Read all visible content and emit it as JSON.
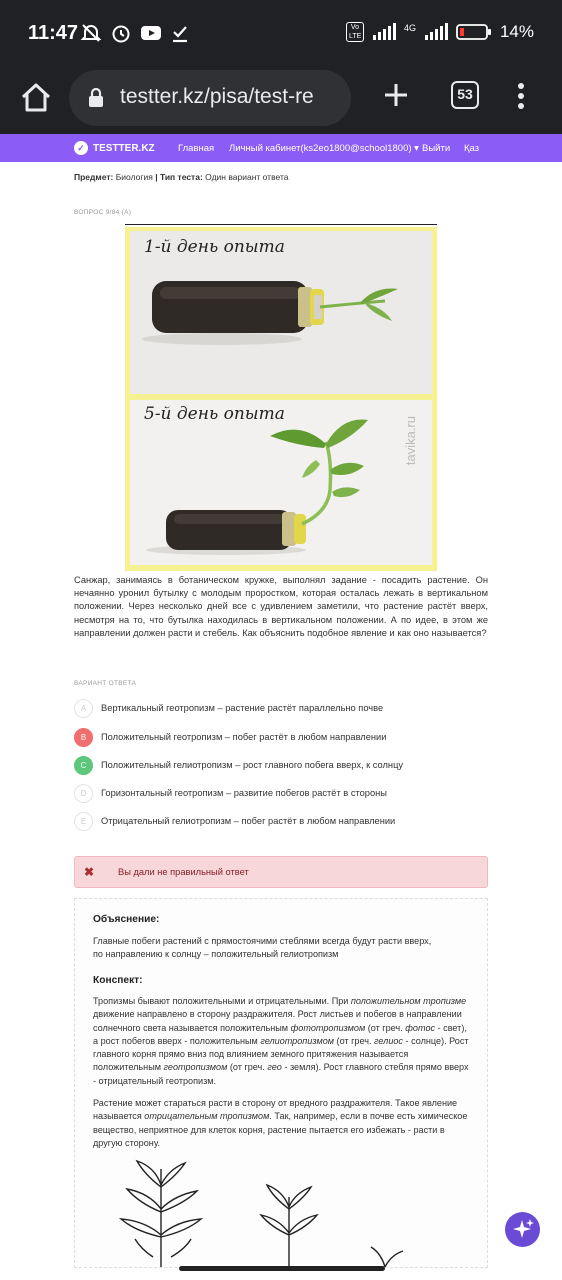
{
  "status_bar": {
    "time": "11:47",
    "signal_label": "4G",
    "volte_label": "Vo LTE",
    "battery": "14%"
  },
  "browser": {
    "url": "testter.kz/pisa/test-re",
    "tab_count": "53"
  },
  "nav": {
    "brand": "TESTTER.KZ",
    "items": [
      "Главная",
      "Личный кабинет(ks2eo1800@school1800) ▾",
      "Выйти",
      "Қаз"
    ]
  },
  "meta": {
    "subject_label": "Предмет:",
    "subject_value": "Биология",
    "separator": "|",
    "type_label": "Тип теста:",
    "type_value": "Один вариант ответа"
  },
  "question": {
    "number": "ВОПРОС 9/84",
    "flag": "(А)",
    "image": {
      "day1_label": "1-й день опыта",
      "day5_label": "5-й день опыта",
      "watermark": "tavika.ru"
    },
    "text": "Санжар, занимаясь в ботаническом кружке, выполнял задание -  посадить растение. Он нечаянно уронил бутылку с молодым проростком, которая осталась лежать в вертикальном положении. Через несколько дней все с удивлением заметили, что растение растёт вверх, несмотря на то, что бутылка находилась в вертикальном положении. А по идее, в этом же направлении должен расти и стебель. Как объяснить подобное явление и как оно называется?"
  },
  "answers": {
    "heading": "ВАРИАНТ ОТВЕТА",
    "options": [
      {
        "letter": "A",
        "text": "Вертикальный геотропизм – растение растёт параллельно почве",
        "state": "none"
      },
      {
        "letter": "B",
        "text": "Положительный геотропизм – побег растёт в любом направлении",
        "state": "wrong"
      },
      {
        "letter": "C",
        "text": "Положительный гелиотропизм – рост главного побега вверх, к солнцу",
        "state": "right"
      },
      {
        "letter": "D",
        "text": "Горизонтальный геотропизм – развитие побегов растёт в стороны",
        "state": "none"
      },
      {
        "letter": "E",
        "text": "Отрицательный гелиотропизм – побег растёт в любом направлении",
        "state": "none"
      }
    ]
  },
  "alert": {
    "icon": "✖",
    "text": "Вы дали не правильный ответ"
  },
  "explanation": {
    "title": "Объяснение:",
    "line1": "Главные побеги растений с прямостоячими стеблями всегда будут расти вверх,",
    "line2": "по направлению к солнцу – положительный гелиотропизм",
    "summary_title": "Конспект:",
    "p1": {
      "a": "Тропизмы бывают положительными и отрицательными. При ",
      "i1": "положительном тропизме",
      "b": " движение направлено в сторону раздражителя. Рост листьев и побегов в направлении солнечного света называется положительным ",
      "i2": "фототропизмом",
      "c": " (от греч. ",
      "i3": "фотос",
      "d": " - свет), а рост побегов вверх - положительным ",
      "i4": "гелиотропизмом",
      "e": " (от греч. ",
      "i5": "гелиос",
      "f": " - солнце). Рост главного корня прямо вниз под влиянием земного притяжения называется положительным ",
      "i6": "геотропизмом",
      "g": " (от греч. ",
      "i7": "гео",
      "h": " - земля). Рост главного стебля прямо вверх - отрицательный геотропизм."
    },
    "p2": {
      "a": "Растение может стараться расти в сторону от вредного раздражителя. Такое явление называется ",
      "i1": "отрицательным тропизмом",
      "b": ". Так, например, если в почве есть химическое вещество, неприятное для клеток корня, растение пытается его избежать - расти в другую сторону."
    }
  },
  "colors": {
    "nav_purple": "#8b5cf6",
    "wrong_red": "#f06e6e",
    "right_green": "#5cc77b",
    "alert_bg": "#f8d7da"
  }
}
